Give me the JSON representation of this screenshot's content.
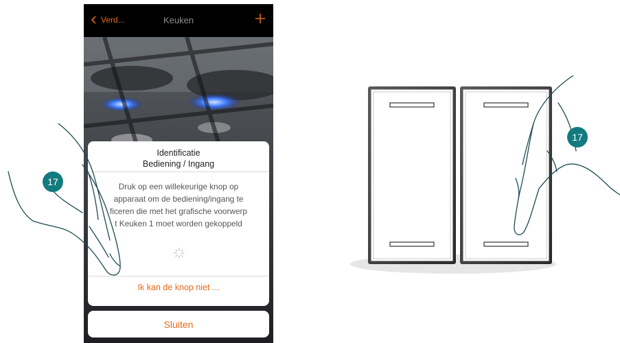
{
  "app": {
    "nav": {
      "back_label": "Verd...",
      "title": "Keuken"
    }
  },
  "dialog": {
    "title_line1": "Identificatie",
    "title_line2": "Bediening / Ingang",
    "body_lines": [
      "Druk op een willekeurige knop op",
      "apparaat om de bediening/ingang te",
      "ficeren die met het grafische voorwerp",
      "t Keuken 1 moet worden gekoppeld"
    ],
    "link_label": "Ik kan de knop niet ..."
  },
  "close_button": {
    "label": "Sluiten"
  },
  "steps": {
    "left": "17",
    "right": "17"
  },
  "colors": {
    "accent": "#e36a1a",
    "badge": "#137b7f",
    "nav_bg": "#000000"
  },
  "icons": [
    "chevron-left-icon",
    "plus-icon",
    "loading-spinner-icon",
    "pointing-hand-icon"
  ]
}
